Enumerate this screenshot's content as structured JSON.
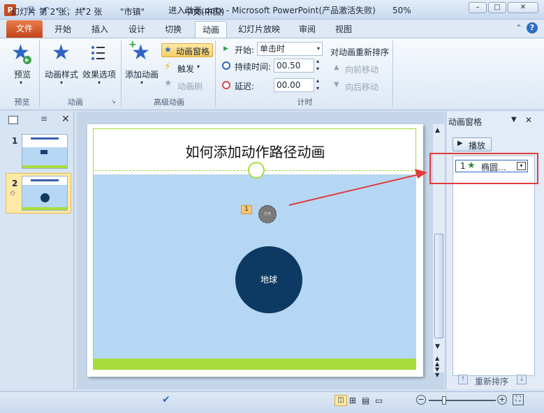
{
  "window": {
    "title": "进入动画.pptx - Microsoft PowerPoint(产品激活失败)"
  },
  "quick_access": [
    "save-icon",
    "undo-icon",
    "redo-icon",
    "customize-icon"
  ],
  "tabs": {
    "file": "文件",
    "home": "开始",
    "insert": "插入",
    "design": "设计",
    "transitions": "切换",
    "animations": "动画",
    "slideshow": "幻灯片放映",
    "review": "审阅",
    "view": "视图"
  },
  "ribbon": {
    "preview": {
      "button": "预览",
      "group": "预览"
    },
    "animation": {
      "style": "动画样式",
      "effects": "效果选项",
      "group": "动画"
    },
    "advanced": {
      "add": "添加动画",
      "pane": "动画窗格",
      "trigger": "触发",
      "painter": "动画刷",
      "group": "高级动画"
    },
    "timing": {
      "start_label": "开始:",
      "start_value": "单击时",
      "duration_label": "持续时间:",
      "duration_value": "00.50",
      "delay_label": "延迟:",
      "delay_value": "00.00",
      "group": "计时",
      "reorder": "对动画重新排序",
      "move_earlier": "向前移动",
      "move_later": "向后移动"
    }
  },
  "slides_panel": {
    "tab_slides": "幻灯片",
    "tab_outline": "大纲",
    "slide_numbers": [
      "1",
      "2"
    ]
  },
  "slide": {
    "title": "如何添加动作路径动画",
    "tag": "1",
    "small_circle_label": "月亮",
    "earth_label": "地球"
  },
  "anim_pane": {
    "title": "动画窗格",
    "play": "播放",
    "item_number": "1",
    "item_name": "椭圆…",
    "reorder": "重新排序"
  },
  "status": {
    "slide_info": "幻灯片 第 2 张，共 2 张",
    "theme": "\"市镇\"",
    "language": "中文(中国)",
    "zoom": "50%"
  },
  "colors": {
    "accent": "#e23b3b",
    "slide_bg": "#b5d7f4",
    "earth": "#0d3a63",
    "green": "#a6dd3c"
  }
}
